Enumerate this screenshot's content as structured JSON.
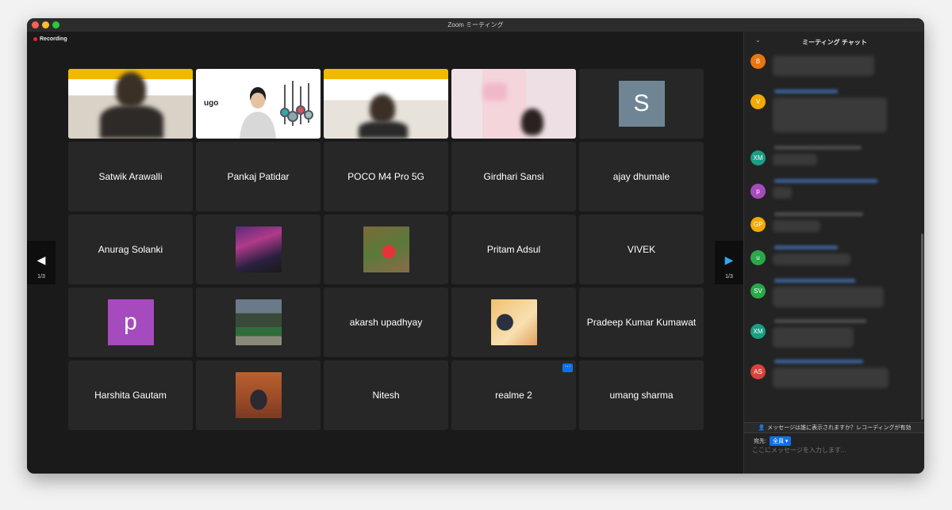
{
  "window": {
    "title": "Zoom ミーティング"
  },
  "recording": {
    "label": "Recording"
  },
  "tiles": [
    {
      "name": "Satwik Arawalli"
    },
    {
      "name": "Pankaj Patidar"
    },
    {
      "name": "POCO M4 Pro 5G"
    },
    {
      "name": "Girdhari Sansi"
    },
    {
      "name": "ajay dhumale"
    },
    {
      "name": "Anurag Solanki"
    },
    {
      "name": "Pritam Adsul"
    },
    {
      "name": "VIVEK"
    },
    {
      "name": "akarsh upadhyay"
    },
    {
      "name": "Pradeep Kumar Kumawat"
    },
    {
      "name": "Harshita Gautam"
    },
    {
      "name": "Nitesh"
    },
    {
      "name": "realme 2"
    },
    {
      "name": "umang sharma"
    }
  ],
  "video_tiles": {
    "ugo_logo": "ugo",
    "s_avatar": "S",
    "p_avatar": "p"
  },
  "colors": {
    "s_avatar": "#6f8593",
    "p_avatar": "#a64bbd",
    "active_speaker": "#2bd046",
    "accent": "#0e71eb"
  },
  "pager": {
    "left": "1/3",
    "right": "1/3"
  },
  "chat": {
    "title": "ミーティング チャット",
    "avatars": [
      {
        "initials": "B",
        "color": "#e8760e"
      },
      {
        "initials": "V",
        "color": "#f2a900"
      },
      {
        "initials": "XM",
        "color": "#1a9e85"
      },
      {
        "initials": "p",
        "color": "#a64bbd"
      },
      {
        "initials": "GP",
        "color": "#f2a900"
      },
      {
        "initials": "u",
        "color": "#2aa84a"
      },
      {
        "initials": "SV",
        "color": "#2aa84a"
      },
      {
        "initials": "XM",
        "color": "#1a9e85"
      },
      {
        "initials": "AS",
        "color": "#d9433c"
      }
    ],
    "notice": "メッセージは誰に表示されますか？レコーディングが有効",
    "to_label": "宛先:",
    "to_value": "全員",
    "input_placeholder": "ここにメッセージを入力します..."
  }
}
